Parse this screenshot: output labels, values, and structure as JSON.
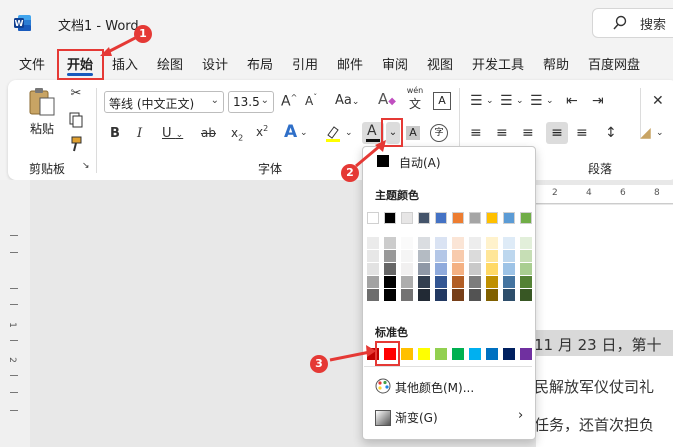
{
  "title_bar": {
    "app_title": "文档1  -  Word",
    "search_label": "搜索"
  },
  "menu_tabs": [
    "文件",
    "开始",
    "插入",
    "绘图",
    "设计",
    "布局",
    "引用",
    "邮件",
    "审阅",
    "视图",
    "开发工具",
    "帮助",
    "百度网盘"
  ],
  "ribbon": {
    "clipboard": {
      "paste_label": "粘贴",
      "group_label": "剪贴板"
    },
    "font": {
      "font_name": "等线 (中文正文)",
      "font_size": "13.5",
      "group_label": "字体",
      "aa_label": "Aa",
      "phonetic_top": "wén",
      "phonetic_bottom": "文",
      "char_border": "A"
    },
    "paragraph": {
      "group_label": "段落"
    }
  },
  "ruler_numbers": [
    "2",
    "4",
    "6",
    "8"
  ],
  "vruler_numbers": [
    "1",
    "2"
  ],
  "document": {
    "line1": "11 月 23 日，第十",
    "line2": "民解放军仪仗司礼",
    "line3": "任务，还首次担负"
  },
  "color_panel": {
    "auto_label": "自动(A)",
    "theme_label": "主题颜色",
    "standard_label": "标准色",
    "more_colors_label": "其他颜色(M)...",
    "gradient_label": "渐变(G)",
    "theme_colors": [
      "#ffffff",
      "#000000",
      "#e7e6e6",
      "#44546a",
      "#4472c4",
      "#ed7d31",
      "#a5a5a5",
      "#ffc000",
      "#5b9bd5",
      "#70ad47"
    ],
    "standard_colors": [
      "#c00000",
      "#ff0000",
      "#ffc000",
      "#ffff00",
      "#92d050",
      "#00b050",
      "#00b0f0",
      "#0070c0",
      "#002060",
      "#7030a0"
    ]
  },
  "annotations": [
    "1",
    "2",
    "3"
  ],
  "colors": {
    "accent": "#185abd",
    "annotation_red": "#e53935"
  }
}
